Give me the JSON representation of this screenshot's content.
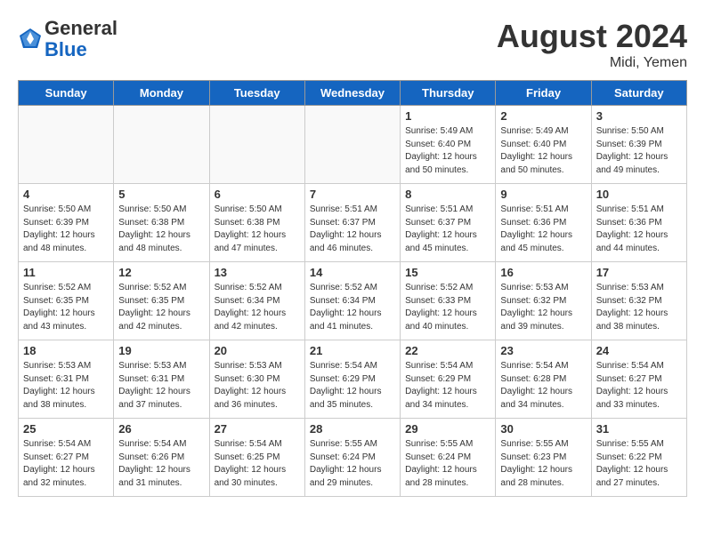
{
  "header": {
    "logo_general": "General",
    "logo_blue": "Blue",
    "month_year": "August 2024",
    "location": "Midi, Yemen"
  },
  "columns": [
    "Sunday",
    "Monday",
    "Tuesday",
    "Wednesday",
    "Thursday",
    "Friday",
    "Saturday"
  ],
  "weeks": [
    [
      {
        "day": "",
        "detail": ""
      },
      {
        "day": "",
        "detail": ""
      },
      {
        "day": "",
        "detail": ""
      },
      {
        "day": "",
        "detail": ""
      },
      {
        "day": "1",
        "detail": "Sunrise: 5:49 AM\nSunset: 6:40 PM\nDaylight: 12 hours\nand 50 minutes."
      },
      {
        "day": "2",
        "detail": "Sunrise: 5:49 AM\nSunset: 6:40 PM\nDaylight: 12 hours\nand 50 minutes."
      },
      {
        "day": "3",
        "detail": "Sunrise: 5:50 AM\nSunset: 6:39 PM\nDaylight: 12 hours\nand 49 minutes."
      }
    ],
    [
      {
        "day": "4",
        "detail": "Sunrise: 5:50 AM\nSunset: 6:39 PM\nDaylight: 12 hours\nand 48 minutes."
      },
      {
        "day": "5",
        "detail": "Sunrise: 5:50 AM\nSunset: 6:38 PM\nDaylight: 12 hours\nand 48 minutes."
      },
      {
        "day": "6",
        "detail": "Sunrise: 5:50 AM\nSunset: 6:38 PM\nDaylight: 12 hours\nand 47 minutes."
      },
      {
        "day": "7",
        "detail": "Sunrise: 5:51 AM\nSunset: 6:37 PM\nDaylight: 12 hours\nand 46 minutes."
      },
      {
        "day": "8",
        "detail": "Sunrise: 5:51 AM\nSunset: 6:37 PM\nDaylight: 12 hours\nand 45 minutes."
      },
      {
        "day": "9",
        "detail": "Sunrise: 5:51 AM\nSunset: 6:36 PM\nDaylight: 12 hours\nand 45 minutes."
      },
      {
        "day": "10",
        "detail": "Sunrise: 5:51 AM\nSunset: 6:36 PM\nDaylight: 12 hours\nand 44 minutes."
      }
    ],
    [
      {
        "day": "11",
        "detail": "Sunrise: 5:52 AM\nSunset: 6:35 PM\nDaylight: 12 hours\nand 43 minutes."
      },
      {
        "day": "12",
        "detail": "Sunrise: 5:52 AM\nSunset: 6:35 PM\nDaylight: 12 hours\nand 42 minutes."
      },
      {
        "day": "13",
        "detail": "Sunrise: 5:52 AM\nSunset: 6:34 PM\nDaylight: 12 hours\nand 42 minutes."
      },
      {
        "day": "14",
        "detail": "Sunrise: 5:52 AM\nSunset: 6:34 PM\nDaylight: 12 hours\nand 41 minutes."
      },
      {
        "day": "15",
        "detail": "Sunrise: 5:52 AM\nSunset: 6:33 PM\nDaylight: 12 hours\nand 40 minutes."
      },
      {
        "day": "16",
        "detail": "Sunrise: 5:53 AM\nSunset: 6:32 PM\nDaylight: 12 hours\nand 39 minutes."
      },
      {
        "day": "17",
        "detail": "Sunrise: 5:53 AM\nSunset: 6:32 PM\nDaylight: 12 hours\nand 38 minutes."
      }
    ],
    [
      {
        "day": "18",
        "detail": "Sunrise: 5:53 AM\nSunset: 6:31 PM\nDaylight: 12 hours\nand 38 minutes."
      },
      {
        "day": "19",
        "detail": "Sunrise: 5:53 AM\nSunset: 6:31 PM\nDaylight: 12 hours\nand 37 minutes."
      },
      {
        "day": "20",
        "detail": "Sunrise: 5:53 AM\nSunset: 6:30 PM\nDaylight: 12 hours\nand 36 minutes."
      },
      {
        "day": "21",
        "detail": "Sunrise: 5:54 AM\nSunset: 6:29 PM\nDaylight: 12 hours\nand 35 minutes."
      },
      {
        "day": "22",
        "detail": "Sunrise: 5:54 AM\nSunset: 6:29 PM\nDaylight: 12 hours\nand 34 minutes."
      },
      {
        "day": "23",
        "detail": "Sunrise: 5:54 AM\nSunset: 6:28 PM\nDaylight: 12 hours\nand 34 minutes."
      },
      {
        "day": "24",
        "detail": "Sunrise: 5:54 AM\nSunset: 6:27 PM\nDaylight: 12 hours\nand 33 minutes."
      }
    ],
    [
      {
        "day": "25",
        "detail": "Sunrise: 5:54 AM\nSunset: 6:27 PM\nDaylight: 12 hours\nand 32 minutes."
      },
      {
        "day": "26",
        "detail": "Sunrise: 5:54 AM\nSunset: 6:26 PM\nDaylight: 12 hours\nand 31 minutes."
      },
      {
        "day": "27",
        "detail": "Sunrise: 5:54 AM\nSunset: 6:25 PM\nDaylight: 12 hours\nand 30 minutes."
      },
      {
        "day": "28",
        "detail": "Sunrise: 5:55 AM\nSunset: 6:24 PM\nDaylight: 12 hours\nand 29 minutes."
      },
      {
        "day": "29",
        "detail": "Sunrise: 5:55 AM\nSunset: 6:24 PM\nDaylight: 12 hours\nand 28 minutes."
      },
      {
        "day": "30",
        "detail": "Sunrise: 5:55 AM\nSunset: 6:23 PM\nDaylight: 12 hours\nand 28 minutes."
      },
      {
        "day": "31",
        "detail": "Sunrise: 5:55 AM\nSunset: 6:22 PM\nDaylight: 12 hours\nand 27 minutes."
      }
    ]
  ]
}
